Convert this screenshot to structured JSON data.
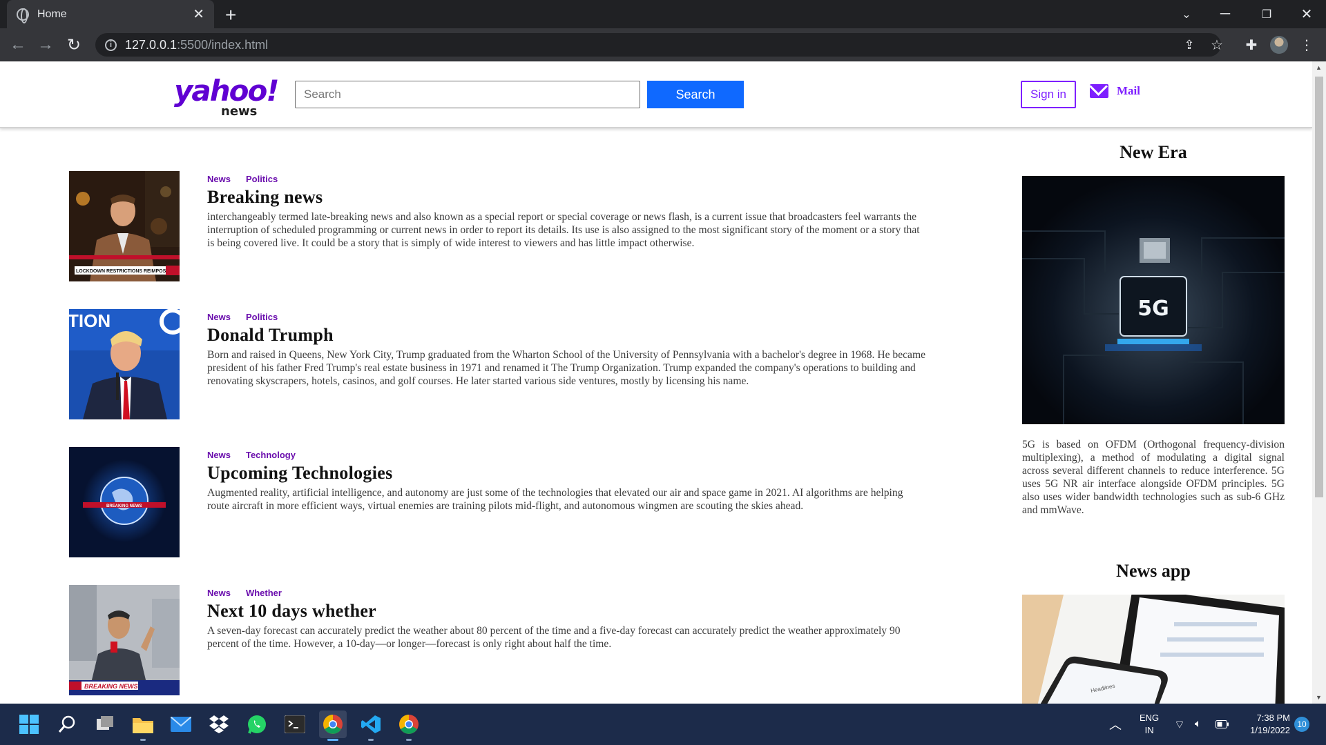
{
  "browser": {
    "tab_title": "Home",
    "url_host": "127.0.0.1",
    "url_path": ":5500/index.html"
  },
  "header": {
    "logo_main": "yahoo!",
    "logo_sub": "news",
    "search_placeholder": "Search",
    "search_button": "Search",
    "signin_button": "Sign in",
    "mail_label": "Mail"
  },
  "articles": [
    {
      "tags": [
        "News",
        "Politics"
      ],
      "title": "Breaking news",
      "text": "interchangeably termed late-breaking news and also known as a special report or special coverage or news flash, is a current issue that broadcasters feel warrants the interruption of scheduled programming or current news in order to report its details. Its use is also assigned to the most significant story of the moment or a story that is being covered live. It could be a story that is simply of wide interest to viewers and has little impact otherwise.",
      "thumb_caption": "LOCKDOWN RESTRICTIONS REIMPOSED"
    },
    {
      "tags": [
        "News",
        "Politics"
      ],
      "title": "Donald Trumph",
      "text": "Born and raised in Queens, New York City, Trump graduated from the Wharton School of the University of Pennsylvania with a bachelor's degree in 1968. He became president of his father Fred Trump's real estate business in 1971 and renamed it The Trump Organization. Trump expanded the company's operations to building and renovating skyscrapers, hotels, casinos, and golf courses. He later started various side ventures, mostly by licensing his name.",
      "thumb_caption": "TION"
    },
    {
      "tags": [
        "News",
        "Technology"
      ],
      "title": "Upcoming Technologies",
      "text": "Augmented reality, artificial intelligence, and autonomy are just some of the technologies that elevated our air and space game in 2021. AI algorithms are helping route aircraft in more efficient ways, virtual enemies are training pilots mid-flight, and autonomous wingmen are scouting the skies ahead.",
      "thumb_caption": "BREAKING NEWS"
    },
    {
      "tags": [
        "News",
        "Whether"
      ],
      "title": "Next 10 days whether",
      "text": "A seven-day forecast can accurately predict the weather about 80 percent of the time and a five-day forecast can accurately predict the weather approximately 90 percent of the time. However, a 10-day—or longer—forecast is only right about half the time.",
      "thumb_caption": "BREAKING NEWS"
    }
  ],
  "sidebar": {
    "section1_title": "New Era",
    "chip_label": "5G",
    "section1_text": "5G is based on OFDM (Orthogonal frequency-division multiplexing), a method of modulating a digital signal across several different channels to reduce interference. 5G uses 5G NR air interface alongside OFDM principles. 5G also uses wider bandwidth technologies such as sub-6 GHz and mmWave.",
    "section2_title": "News app",
    "phone_label": "Headlines"
  },
  "taskbar": {
    "lang": "ENG",
    "region": "IN",
    "time": "7:38 PM",
    "date": "1/19/2022",
    "notif_count": "10"
  }
}
